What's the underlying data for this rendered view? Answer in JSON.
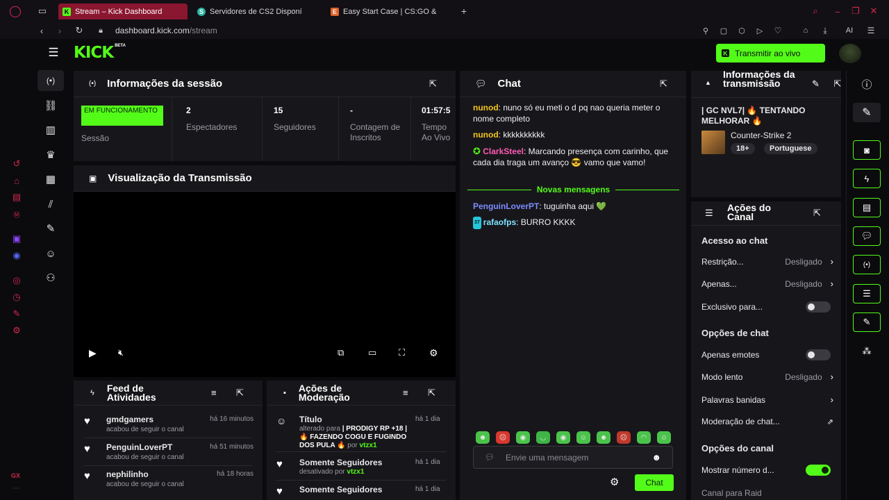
{
  "browser": {
    "tabs": [
      {
        "label": "Stream – Kick Dashboard",
        "favicon": "K"
      },
      {
        "label": "Servidores de CS2 Disponí",
        "favicon": "S"
      },
      {
        "label": "Easy Start Case | CS:GO &",
        "favicon": "E"
      }
    ],
    "url_host": "dashboard.kick.com",
    "url_path": "/stream",
    "ai_label": "AI",
    "gx_label": "GX"
  },
  "header": {
    "logo": "KICK",
    "logo_badge": "BETA",
    "go_live_label": "Transmitir ao vivo"
  },
  "session": {
    "title": "Informações da sessão",
    "status_badge": "EM FUNCIONAMENTO",
    "status_label": "Sessão",
    "stats": [
      {
        "value": "2",
        "label": "Espectadores"
      },
      {
        "value": "15",
        "label": "Seguidores"
      },
      {
        "value": "-",
        "label": "Contagem de Inscritos"
      },
      {
        "value": "01:57:5",
        "label": "Tempo Ao Vivo"
      }
    ]
  },
  "preview": {
    "title": "Visualização da Transmissão"
  },
  "activity": {
    "title": "Feed de Atividades",
    "items": [
      {
        "user": "gmdgamers",
        "time": "há 16 minutos",
        "desc": "acabou de seguir o canal"
      },
      {
        "user": "PenguinLoverPT",
        "time": "há 51 minutos",
        "desc": "acabou de seguir o canal"
      },
      {
        "user": "nephilinho",
        "time": "há 18 horas",
        "desc": "acabou de seguir o canal"
      }
    ]
  },
  "moderation": {
    "title": "Ações de Moderação",
    "items": [
      {
        "title": "Título",
        "time": "há 1 dia",
        "line1_prefix": "alterado para ",
        "line1_bold": "| PRODIGY RP +18 |",
        "line2": "🔥 FAZENDO COGU E FUGINDO",
        "line3": "DOS PULA 🔥",
        "by_prefix": " por ",
        "by_user": "vtzx1"
      },
      {
        "title": "Somente Seguidores",
        "time": "há 1 dia",
        "desc_prefix": "desativado por ",
        "by_user": "vtzx1"
      },
      {
        "title": "Somente Seguidores",
        "time": "há 1 dia"
      }
    ]
  },
  "chat": {
    "title": "Chat",
    "messages": [
      {
        "user": "nunod",
        "color": "#f5c518",
        "text": "nuno só eu meti o d pq nao queria meter o nome completo"
      },
      {
        "user": "nunod",
        "color": "#f5c518",
        "text": "kkkkkkkkkk"
      },
      {
        "user": "ClarkSteel",
        "color": "#ff5ab4",
        "text": "Marcando presença com carinho, que cada dia traga um avanço 😎 vamo que vamo!"
      }
    ],
    "new_messages_label": "Novas mensagens",
    "new_messages": [
      {
        "user": "PenguinLoverPT",
        "color": "#7d8cff",
        "text": "tuguinha aqui 💚"
      },
      {
        "user": "rafaofps",
        "color": "#7ee0ff",
        "badge": "37",
        "text": "BURRO KKKK"
      }
    ],
    "input_placeholder": "Envie uma mensagem",
    "send_label": "Chat"
  },
  "stream_info": {
    "title": "Informações da transmissão",
    "stream_title": "| GC NVL7| 🔥 TENTANDO MELHORAR 🔥",
    "game": "Counter-Strike 2",
    "tags": [
      "18+",
      "Portuguese"
    ]
  },
  "channel_actions": {
    "title": "Ações do Canal",
    "chat_access_header": "Acesso ao chat",
    "restriction_label": "Restrição...",
    "restriction_value": "Desligado",
    "apenas_label": "Apenas...",
    "apenas_value": "Desligado",
    "exclusive_label": "Exclusivo para...",
    "chat_options_header": "Opções de chat",
    "emotes_only_label": "Apenas emotes",
    "slow_mode_label": "Modo lento",
    "slow_mode_value": "Desligado",
    "banned_words_label": "Palavras banidas",
    "chat_mod_label": "Moderação de chat...",
    "channel_options_header": "Opções do canal",
    "show_number_label": "Mostrar número d...",
    "raid_label": "Canal para Raid"
  },
  "colors": {
    "accent": "#53fc18",
    "panel": "#17171b",
    "tab_active": "#8a1630"
  }
}
